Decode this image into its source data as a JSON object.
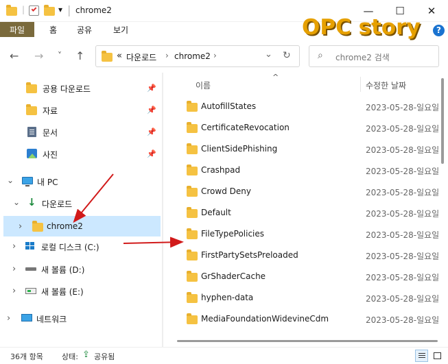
{
  "titlebar": {
    "title": "chrome2",
    "separator": "|",
    "dropdown_glyph": "▾",
    "minimize": "—",
    "maximize": "☐",
    "close": "✕"
  },
  "ribbon": {
    "tabs": [
      "파일",
      "홈",
      "공유",
      "보기"
    ]
  },
  "watermark": {
    "text": "OPC story",
    "color": "#e6a000"
  },
  "help_icon": "?",
  "nav": {
    "back": "←",
    "forward": "→",
    "recent": "˅",
    "up": "↑"
  },
  "address": {
    "prefix": "«",
    "path": [
      "다운로드",
      "chrome2"
    ],
    "sep": "›",
    "refresh": "↻",
    "dropdown": "⌄"
  },
  "search": {
    "icon": "⌕",
    "placeholder": "chrome2 검색"
  },
  "navpane": {
    "quick_access": [
      {
        "label": "공용 다운로드",
        "icon": "folder-icon",
        "pin": "📌"
      },
      {
        "label": "자료",
        "icon": "folder-icon",
        "pin": "📌"
      },
      {
        "label": "문서",
        "icon": "document-icon",
        "pin": "📌"
      },
      {
        "label": "사진",
        "icon": "picture-icon",
        "pin": "📌"
      }
    ],
    "this_pc": "내 PC",
    "downloads": "다운로드",
    "selected": "chrome2",
    "drives": [
      "로컬 디스크 (C:)",
      "새 볼륨 (D:)",
      "새 볼륨 (E:)"
    ],
    "network": "네트워크",
    "chev_expanded": "⌄",
    "chev_collapsed": "›"
  },
  "columns": {
    "name": "이름",
    "date": "수정한 날짜",
    "sort_indicator": "^"
  },
  "files": [
    {
      "name": "AutofillStates",
      "date": "2023-05-28-일요일"
    },
    {
      "name": "CertificateRevocation",
      "date": "2023-05-28-일요일"
    },
    {
      "name": "ClientSidePhishing",
      "date": "2023-05-28-일요일"
    },
    {
      "name": "Crashpad",
      "date": "2023-05-28-일요일"
    },
    {
      "name": "Crowd Deny",
      "date": "2023-05-28-일요일"
    },
    {
      "name": "Default",
      "date": "2023-05-28-일요일"
    },
    {
      "name": "FileTypePolicies",
      "date": "2023-05-28-일요일"
    },
    {
      "name": "FirstPartySetsPreloaded",
      "date": "2023-05-28-일요일"
    },
    {
      "name": "GrShaderCache",
      "date": "2023-05-28-일요일"
    },
    {
      "name": "hyphen-data",
      "date": "2023-05-28-일요일"
    },
    {
      "name": "MediaFoundationWidevineCdm",
      "date": "2023-05-28-일요일"
    }
  ],
  "status": {
    "count": "36개 항목",
    "state_label": "상태:",
    "state_value": "공유됨"
  },
  "colors": {
    "accent_file_tab": "#7a6a3c",
    "selection": "#cce8ff",
    "folder": "#f5c242",
    "arrow": "#d11a1a"
  }
}
